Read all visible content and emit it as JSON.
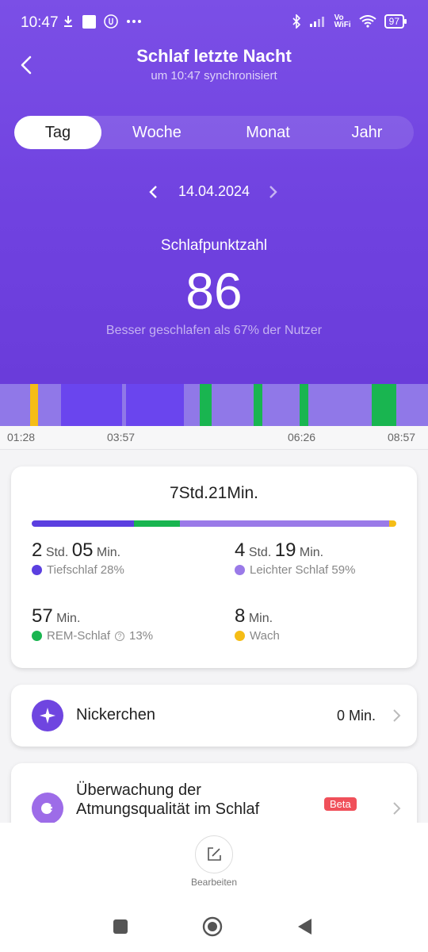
{
  "status_bar": {
    "time": "10:47",
    "icons_left": [
      "download-icon",
      "square-icon",
      "hands-icon",
      "more-icon"
    ],
    "vowifi_label": "Vo\nWiFi",
    "battery": "97"
  },
  "header": {
    "title": "Schlaf letzte Nacht",
    "subtitle": "um 10:47 synchronisiert"
  },
  "tabs": [
    {
      "label": "Tag",
      "active": true
    },
    {
      "label": "Woche",
      "active": false
    },
    {
      "label": "Monat",
      "active": false
    },
    {
      "label": "Jahr",
      "active": false
    }
  ],
  "date": "14.04.2024",
  "score": {
    "label": "Schlafpunktzahl",
    "value": "86",
    "note": "Besser geschlafen als 67% der Nutzer"
  },
  "timeline": {
    "ticks": [
      "01:28",
      "03:57",
      "06:26",
      "08:57"
    ]
  },
  "summary": {
    "total": "7Std.21Min.",
    "deep": {
      "h": "2",
      "h_unit": "Std.",
      "m": "05",
      "m_unit": "Min.",
      "label": "Tiefschlaf 28%",
      "percent": 28
    },
    "light": {
      "h": "4",
      "h_unit": "Std.",
      "m": "19",
      "m_unit": "Min.",
      "label": "Leichter Schlaf 59%",
      "percent": 59
    },
    "rem": {
      "m": "57",
      "m_unit": "Min.",
      "label": "REM-Schlaf",
      "pct_label": "13%",
      "percent": 13
    },
    "awake": {
      "m": "8",
      "m_unit": "Min.",
      "label": "Wach"
    }
  },
  "colors": {
    "deep": "#5b3fe0",
    "light": "#9a7ae8",
    "rem": "#19b550",
    "awake": "#f5bd16",
    "accent": "#6f45e0"
  },
  "nap": {
    "title": "Nickerchen",
    "value": "0 Min."
  },
  "breathing": {
    "title_line1": "Überwachung der",
    "title_line2": "Atmungsqualität im Schlaf",
    "badge": "Beta"
  },
  "bottom": {
    "edit_label": "Bearbeiten"
  }
}
